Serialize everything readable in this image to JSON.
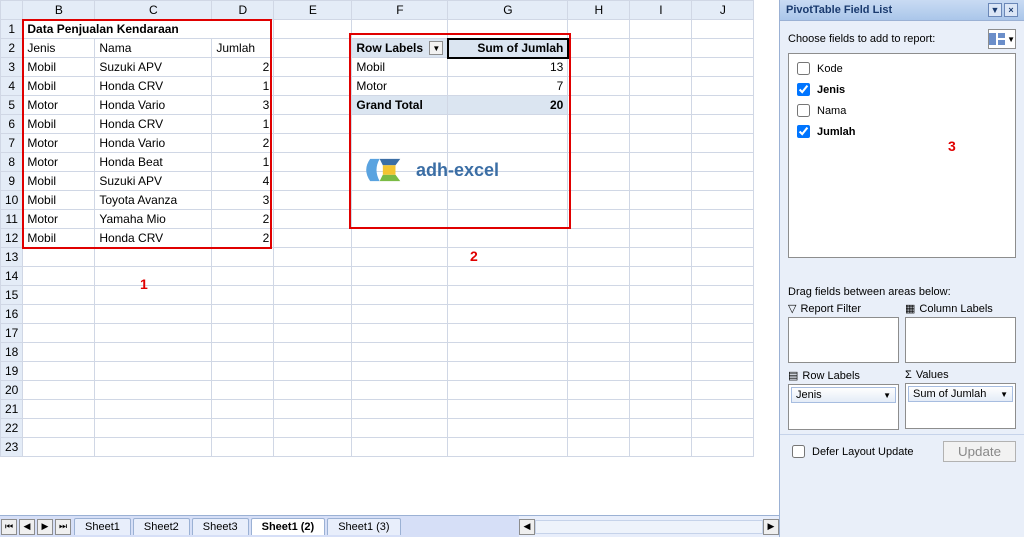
{
  "columns": [
    "",
    "B",
    "C",
    "D",
    "E",
    "F",
    "G",
    "H",
    "I",
    "J"
  ],
  "rows": [
    "1",
    "2",
    "3",
    "4",
    "5",
    "6",
    "7",
    "8",
    "9",
    "10",
    "11",
    "12",
    "13",
    "14",
    "15",
    "16",
    "17",
    "18",
    "19",
    "20",
    "21",
    "22",
    "23"
  ],
  "title_cell": "Data Penjualan Kendaraan",
  "headers": {
    "jenis": "Jenis",
    "nama": "Nama",
    "jumlah": "Jumlah"
  },
  "data": [
    {
      "jenis": "Mobil",
      "nama": "Suzuki APV",
      "jumlah": "2"
    },
    {
      "jenis": "Mobil",
      "nama": "Honda CRV",
      "jumlah": "1"
    },
    {
      "jenis": "Motor",
      "nama": "Honda Vario",
      "jumlah": "3"
    },
    {
      "jenis": "Mobil",
      "nama": "Honda CRV",
      "jumlah": "1"
    },
    {
      "jenis": "Motor",
      "nama": "Honda Vario",
      "jumlah": "2"
    },
    {
      "jenis": "Motor",
      "nama": "Honda Beat",
      "jumlah": "1"
    },
    {
      "jenis": "Mobil",
      "nama": "Suzuki APV",
      "jumlah": "4"
    },
    {
      "jenis": "Mobil",
      "nama": "Toyota Avanza",
      "jumlah": "3"
    },
    {
      "jenis": "Motor",
      "nama": "Yamaha Mio",
      "jumlah": "2"
    },
    {
      "jenis": "Mobil",
      "nama": "Honda CRV",
      "jumlah": "2"
    }
  ],
  "pivot": {
    "rowlabels_hdr": "Row Labels",
    "sum_hdr": "Sum of Jumlah",
    "rows": [
      {
        "label": "Mobil",
        "value": "13"
      },
      {
        "label": "Motor",
        "value": "7"
      }
    ],
    "grand_label": "Grand Total",
    "grand_value": "20"
  },
  "annotations": {
    "a1": "1",
    "a2": "2",
    "a3": "3"
  },
  "logo_text": "adh-excel",
  "tabs": {
    "t1": "Sheet1",
    "t2": "Sheet2",
    "t3": "Sheet3",
    "active": "Sheet1 (2)",
    "t5": "Sheet1 (3)"
  },
  "panel": {
    "title": "PivotTable Field List",
    "choose_label": "Choose fields to add to report:",
    "fields": [
      {
        "name": "Kode",
        "checked": false
      },
      {
        "name": "Jenis",
        "checked": true
      },
      {
        "name": "Nama",
        "checked": false
      },
      {
        "name": "Jumlah",
        "checked": true
      }
    ],
    "drag_hint": "Drag fields between areas below:",
    "area_filter": "Report Filter",
    "area_cols": "Column Labels",
    "area_rows": "Row Labels",
    "area_vals": "Values",
    "chip_rows": "Jenis",
    "chip_vals": "Sum of Jumlah",
    "defer_label": "Defer Layout Update",
    "update_btn": "Update"
  }
}
